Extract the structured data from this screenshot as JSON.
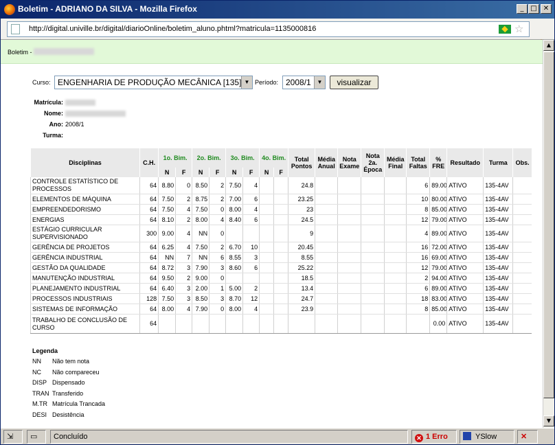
{
  "window": {
    "title": "Boletim - ADRIANO DA SILVA - Mozilla Firefox"
  },
  "browser": {
    "url": "http://digital.univille.br/digital/diarioOnline/boletim_aluno.phtml?matricula=1135000816",
    "status": "Concluído",
    "errors": "1 Erro",
    "yslow": "YSlow"
  },
  "page": {
    "header_label": "Boletim -",
    "curso_label": "Curso:",
    "curso_value": "ENGENHARIA DE PRODUÇÃO MECÂNICA [135]",
    "periodo_label": "Período:",
    "periodo_value": "2008/1",
    "visualizar_label": "visualizar",
    "matricula_label": "Matrícula:",
    "nome_label": "Nome:",
    "ano_label": "Ano:",
    "ano_value": "2008/1",
    "turma_label": "Turma:"
  },
  "table": {
    "headers": {
      "disciplinas": "Disciplinas",
      "ch": "C.H.",
      "bim1": "1o. Bim.",
      "bim2": "2o. Bim.",
      "bim3": "3o. Bim.",
      "bim4": "4o. Bim.",
      "n": "N",
      "f": "F",
      "total_pontos": "Total Pontos",
      "media_anual": "Média Anual",
      "nota_exame": "Nota Exame",
      "nota_2a_epoca": "Nota 2a. Época",
      "media_final": "Média Final",
      "total_faltas": "Total Faltas",
      "fre": "% FRE",
      "resultado": "Resultado",
      "turma": "Turma",
      "obs": "Obs."
    },
    "rows": [
      {
        "disc": "CONTROLE ESTATÍSTICO DE PROCESSOS",
        "ch": "64",
        "n1": "8.80",
        "f1": "0",
        "n2": "8.50",
        "f2": "2",
        "n3": "7.50",
        "f3": "4",
        "n4": "",
        "f4": "",
        "tp": "24.8",
        "ma": "",
        "ne": "",
        "n2e": "",
        "mf": "",
        "tf": "6",
        "fre": "89.00",
        "res": "ATIVO",
        "turma": "135-4AV",
        "obs": ""
      },
      {
        "disc": "ELEMENTOS DE MÁQUINA",
        "ch": "64",
        "n1": "7.50",
        "f1": "2",
        "n2": "8.75",
        "f2": "2",
        "n3": "7.00",
        "f3": "6",
        "n4": "",
        "f4": "",
        "tp": "23.25",
        "ma": "",
        "ne": "",
        "n2e": "",
        "mf": "",
        "tf": "10",
        "fre": "80.00",
        "res": "ATIVO",
        "turma": "135-4AV",
        "obs": ""
      },
      {
        "disc": "EMPREENDEDORISMO",
        "ch": "64",
        "n1": "7.50",
        "f1": "4",
        "n2": "7.50",
        "f2": "0",
        "n3": "8.00",
        "f3": "4",
        "n4": "",
        "f4": "",
        "tp": "23",
        "ma": "",
        "ne": "",
        "n2e": "",
        "mf": "",
        "tf": "8",
        "fre": "85.00",
        "res": "ATIVO",
        "turma": "135-4AV",
        "obs": ""
      },
      {
        "disc": "ENERGIAS",
        "ch": "64",
        "n1": "8.10",
        "f1": "2",
        "n2": "8.00",
        "f2": "4",
        "n3": "8.40",
        "f3": "6",
        "n4": "",
        "f4": "",
        "tp": "24.5",
        "ma": "",
        "ne": "",
        "n2e": "",
        "mf": "",
        "tf": "12",
        "fre": "79.00",
        "res": "ATIVO",
        "turma": "135-4AV",
        "obs": ""
      },
      {
        "disc": "ESTÁGIO CURRICULAR SUPERVISIONADO",
        "ch": "300",
        "n1": "9.00",
        "f1": "4",
        "n2": "NN",
        "f2": "0",
        "n3": "",
        "f3": "",
        "n4": "",
        "f4": "",
        "tp": "9",
        "ma": "",
        "ne": "",
        "n2e": "",
        "mf": "",
        "tf": "4",
        "fre": "89.00",
        "res": "ATIVO",
        "turma": "135-4AV",
        "obs": ""
      },
      {
        "disc": "GERÊNCIA DE PROJETOS",
        "ch": "64",
        "n1": "6.25",
        "f1": "4",
        "n2": "7.50",
        "f2": "2",
        "n3": "6.70",
        "f3": "10",
        "n4": "",
        "f4": "",
        "tp": "20.45",
        "ma": "",
        "ne": "",
        "n2e": "",
        "mf": "",
        "tf": "16",
        "fre": "72.00",
        "res": "ATIVO",
        "turma": "135-4AV",
        "obs": ""
      },
      {
        "disc": "GERÊNCIA INDUSTRIAL",
        "ch": "64",
        "n1": "NN",
        "f1": "7",
        "n2": "NN",
        "f2": "6",
        "n3": "8.55",
        "f3": "3",
        "n4": "",
        "f4": "",
        "tp": "8.55",
        "ma": "",
        "ne": "",
        "n2e": "",
        "mf": "",
        "tf": "16",
        "fre": "69.00",
        "res": "ATIVO",
        "turma": "135-4AV",
        "obs": ""
      },
      {
        "disc": "GESTÃO DA QUALIDADE",
        "ch": "64",
        "n1": "8.72",
        "f1": "3",
        "n2": "7.90",
        "f2": "3",
        "n3": "8.60",
        "f3": "6",
        "n4": "",
        "f4": "",
        "tp": "25.22",
        "ma": "",
        "ne": "",
        "n2e": "",
        "mf": "",
        "tf": "12",
        "fre": "79.00",
        "res": "ATIVO",
        "turma": "135-4AV",
        "obs": ""
      },
      {
        "disc": "MANUTENÇÃO INDUSTRIAL",
        "ch": "64",
        "n1": "9.50",
        "f1": "2",
        "n2": "9.00",
        "f2": "0",
        "n3": "",
        "f3": "",
        "n4": "",
        "f4": "",
        "tp": "18.5",
        "ma": "",
        "ne": "",
        "n2e": "",
        "mf": "",
        "tf": "2",
        "fre": "94.00",
        "res": "ATIVO",
        "turma": "135-4AV",
        "obs": ""
      },
      {
        "disc": "PLANEJAMENTO INDUSTRIAL",
        "ch": "64",
        "n1": "6.40",
        "f1": "3",
        "n2": "2.00",
        "f2": "1",
        "n3": "5.00",
        "f3": "2",
        "n4": "",
        "f4": "",
        "tp": "13.4",
        "ma": "",
        "ne": "",
        "n2e": "",
        "mf": "",
        "tf": "6",
        "fre": "89.00",
        "res": "ATIVO",
        "turma": "135-4AV",
        "obs": ""
      },
      {
        "disc": "PROCESSOS INDUSTRIAIS",
        "ch": "128",
        "n1": "7.50",
        "f1": "3",
        "n2": "8.50",
        "f2": "3",
        "n3": "8.70",
        "f3": "12",
        "n4": "",
        "f4": "",
        "tp": "24.7",
        "ma": "",
        "ne": "",
        "n2e": "",
        "mf": "",
        "tf": "18",
        "fre": "83.00",
        "res": "ATIVO",
        "turma": "135-4AV",
        "obs": ""
      },
      {
        "disc": "SISTEMAS DE INFORMAÇÃO",
        "ch": "64",
        "n1": "8.00",
        "f1": "4",
        "n2": "7.90",
        "f2": "0",
        "n3": "8.00",
        "f3": "4",
        "n4": "",
        "f4": "",
        "tp": "23.9",
        "ma": "",
        "ne": "",
        "n2e": "",
        "mf": "",
        "tf": "8",
        "fre": "85.00",
        "res": "ATIVO",
        "turma": "135-4AV",
        "obs": ""
      },
      {
        "disc": "TRABALHO DE CONCLUSÃO DE CURSO",
        "ch": "64",
        "n1": "",
        "f1": "",
        "n2": "",
        "f2": "",
        "n3": "",
        "f3": "",
        "n4": "",
        "f4": "",
        "tp": "",
        "ma": "",
        "ne": "",
        "n2e": "",
        "mf": "",
        "tf": "",
        "fre": "0.00",
        "res": "ATIVO",
        "turma": "135-4AV",
        "obs": ""
      }
    ]
  },
  "legend": {
    "title": "Legenda",
    "items": [
      {
        "code": "NN",
        "desc": "Não tem nota"
      },
      {
        "code": "NC",
        "desc": "Não compareceu"
      },
      {
        "code": "DISP",
        "desc": "Dispensado"
      },
      {
        "code": "TRAN",
        "desc": "Transferido"
      },
      {
        "code": "M.TR",
        "desc": "Matrícula Trancada"
      },
      {
        "code": "DESI",
        "desc": "Desistência"
      }
    ]
  }
}
